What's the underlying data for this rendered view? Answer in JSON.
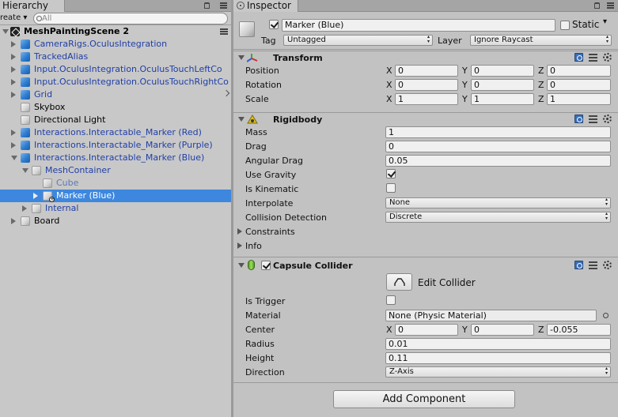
{
  "hierarchy": {
    "tab_title": "Hierarchy",
    "create_label": "reate ▾",
    "search_placeholder": "All",
    "scene_name": "MeshPaintingScene 2",
    "items": [
      {
        "label": "CameraRigs.OculusIntegration",
        "style": "blue",
        "icon": "prefab-icon",
        "arrow": "collapsed"
      },
      {
        "label": "TrackedAlias",
        "style": "blue",
        "icon": "prefab-icon",
        "arrow": "collapsed"
      },
      {
        "label": "Input.OculusIntegration.OculusTouchLeftCo",
        "style": "blue",
        "icon": "prefab-icon",
        "arrow": "collapsed"
      },
      {
        "label": "Input.OculusIntegration.OculusTouchRightCo",
        "style": "blue",
        "icon": "prefab-icon",
        "arrow": "collapsed"
      },
      {
        "label": "Grid",
        "style": "blue",
        "icon": "prefab-icon",
        "arrow": "collapsed"
      },
      {
        "label": "Skybox",
        "style": "normal",
        "icon": "gameobject-icon",
        "arrow": "none"
      },
      {
        "label": "Directional Light",
        "style": "normal",
        "icon": "gameobject-icon",
        "arrow": "none"
      },
      {
        "label": "Interactions.Interactable_Marker (Red)",
        "style": "blue",
        "icon": "prefab-icon",
        "arrow": "collapsed"
      },
      {
        "label": "Interactions.Interactable_Marker (Purple)",
        "style": "blue",
        "icon": "prefab-icon",
        "arrow": "collapsed"
      },
      {
        "label": "Interactions.Interactable_Marker (Blue)",
        "style": "blue",
        "icon": "prefab-icon",
        "arrow": "expanded"
      },
      {
        "label": "MeshContainer",
        "style": "blue",
        "icon": "gameobject-icon",
        "arrow": "expanded"
      },
      {
        "label": "Cube",
        "style": "dim",
        "icon": "gameobject-icon",
        "arrow": "none"
      },
      {
        "label": "Marker (Blue)",
        "style": "selected",
        "icon": "gameobject-added-icon",
        "arrow": "collapsed"
      },
      {
        "label": "Internal",
        "style": "blue",
        "icon": "gameobject-icon",
        "arrow": "collapsed"
      },
      {
        "label": "Board",
        "style": "normal",
        "icon": "gameobject-icon",
        "arrow": "collapsed"
      }
    ]
  },
  "inspector": {
    "tab_title": "Inspector",
    "object_name": "Marker (Blue)",
    "active": true,
    "static_label": "Static",
    "tag_label": "Tag",
    "tag_value": "Untagged",
    "layer_label": "Layer",
    "layer_value": "Ignore Raycast",
    "transform": {
      "title": "Transform",
      "rows": [
        {
          "label": "Position",
          "x": "0",
          "y": "0",
          "z": "0"
        },
        {
          "label": "Rotation",
          "x": "0",
          "y": "0",
          "z": "0"
        },
        {
          "label": "Scale",
          "x": "1",
          "y": "1",
          "z": "1"
        }
      ]
    },
    "rigidbody": {
      "title": "Rigidbody",
      "mass_label": "Mass",
      "mass": "1",
      "drag_label": "Drag",
      "drag": "0",
      "angular_drag_label": "Angular Drag",
      "angular_drag": "0.05",
      "use_gravity_label": "Use Gravity",
      "use_gravity": true,
      "is_kinematic_label": "Is Kinematic",
      "is_kinematic": false,
      "interpolate_label": "Interpolate",
      "interpolate": "None",
      "collision_label": "Collision Detection",
      "collision": "Discrete",
      "constraints_label": "Constraints",
      "info_label": "Info"
    },
    "capsule": {
      "title": "Capsule Collider",
      "enabled": true,
      "edit_collider_label": "Edit Collider",
      "is_trigger_label": "Is Trigger",
      "is_trigger": false,
      "material_label": "Material",
      "material": "None (Physic Material)",
      "center_label": "Center",
      "center_x": "0",
      "center_y": "0",
      "center_z": "-0.055",
      "radius_label": "Radius",
      "radius": "0.01",
      "height_label": "Height",
      "height": "0.11",
      "direction_label": "Direction",
      "direction": "Z-Axis"
    },
    "add_component_label": "Add Component",
    "axis_x": "X",
    "axis_y": "Y",
    "axis_z": "Z"
  }
}
